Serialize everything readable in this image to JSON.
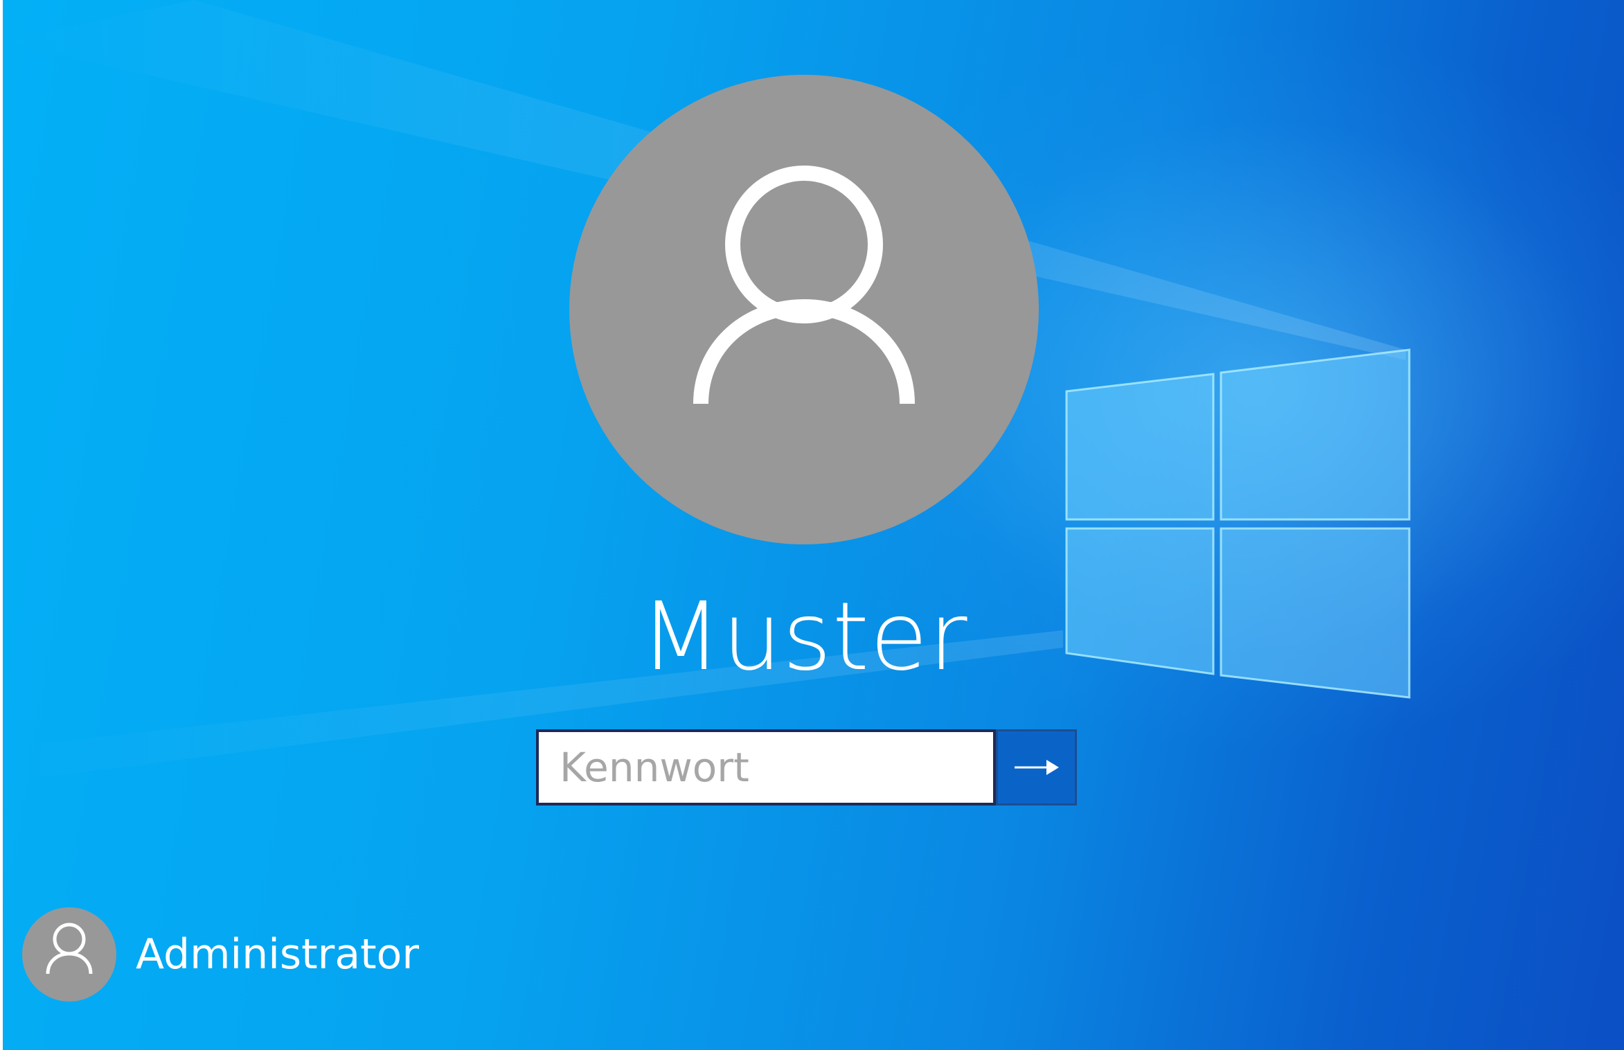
{
  "login": {
    "user_name": "Muster",
    "password_placeholder": "Kennwort",
    "submit_icon": "arrow-right-icon",
    "avatar_icon": "user-icon"
  },
  "other_users": [
    {
      "name": "Administrator",
      "avatar_icon": "user-icon"
    }
  ],
  "colors": {
    "avatar_bg": "#989898",
    "submit_bg": "#0a64c8",
    "input_border": "#1c2b5a",
    "text": "#ffffff"
  }
}
